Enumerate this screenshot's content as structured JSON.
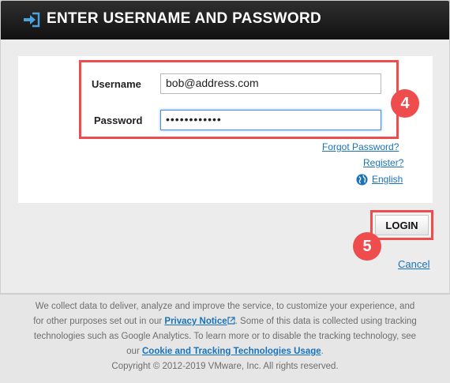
{
  "header": {
    "title": "ENTER USERNAME AND PASSWORD",
    "icon": "sign-in-icon"
  },
  "form": {
    "username_label": "Username",
    "username_value": "bob@address.com",
    "password_label": "Password",
    "password_value": "••••••••••••"
  },
  "links": {
    "forgot_password": "Forgot Password?",
    "register": "Register?",
    "language": "English"
  },
  "buttons": {
    "login": "LOGIN",
    "cancel": "Cancel"
  },
  "callouts": {
    "step_4": "4",
    "step_5": "5"
  },
  "footer": {
    "line1": "We collect data to deliver, analyze and improve the service, to customize your experience, and",
    "line2_pre": "for other purposes set out in our ",
    "privacy_link": "Privacy Notice",
    "line2_post": ". Some of this data is collected using tracking",
    "line3": "technologies such as Google Analytics. To learn more or to disable the tracking technology, see",
    "line4_pre": "our ",
    "cookie_link": "Cookie and Tracking Technologies Usage",
    "line4_post": ".",
    "copyright": "Copyright © 2012-2019 VMware, Inc. All rights reserved."
  },
  "colors": {
    "accent_link": "#1a73b8",
    "callout_red": "#ef4d4d",
    "header_bg": "#1a1a1a"
  }
}
